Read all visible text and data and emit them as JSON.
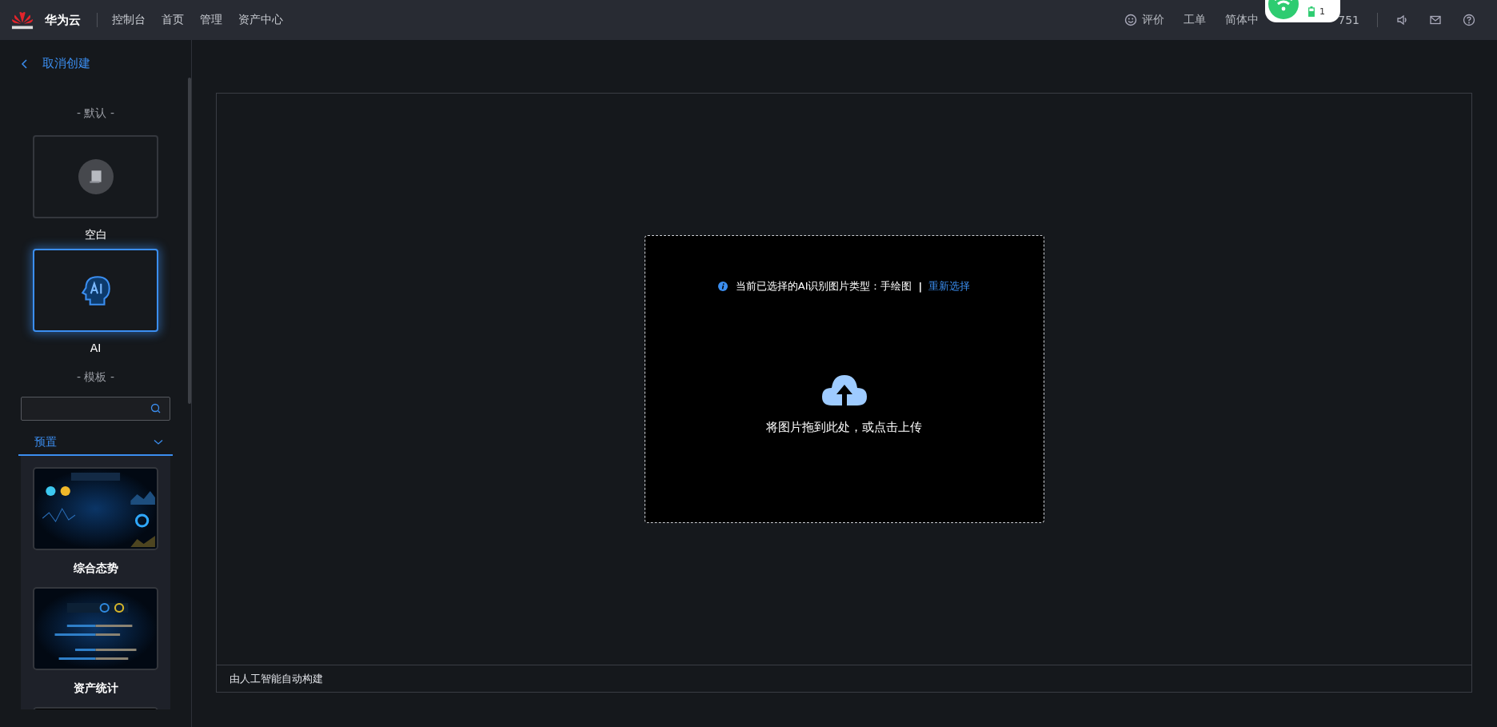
{
  "header": {
    "brand": "华为云",
    "nav": [
      {
        "label": "控制台"
      },
      {
        "label": "首页"
      },
      {
        "label": "管理"
      },
      {
        "label": "资产中心"
      }
    ],
    "actions": [
      {
        "kind": "feedback",
        "label": "评价"
      },
      {
        "kind": "text",
        "label": "工单"
      },
      {
        "kind": "text",
        "label": "简体中"
      },
      {
        "kind": "account",
        "label": "751"
      }
    ],
    "icons": [
      {
        "kind": "sound"
      },
      {
        "kind": "mail"
      },
      {
        "kind": "help"
      }
    ],
    "popup": {
      "count": "1"
    }
  },
  "back_link": "取消创建",
  "sidebar": {
    "default_title": "- 默认 -",
    "defaults": [
      {
        "label": "空白",
        "selected": false
      },
      {
        "label": "AI",
        "selected": true
      }
    ],
    "template_title": "- 模板 -",
    "group": {
      "label": "预置",
      "expanded": true
    },
    "templates": [
      {
        "label": "综合态势",
        "kind": "picture"
      },
      {
        "label": "资产统计",
        "kind": "picture"
      },
      {
        "kind": "picture"
      }
    ]
  },
  "canvas": {
    "info": "当前已选择的AI识别图片类型：手绘图",
    "separator": "|",
    "link": "重新选择",
    "upload_hint": "将图片拖到此处，或点击上传",
    "footer": "由人工智能自动构建"
  }
}
